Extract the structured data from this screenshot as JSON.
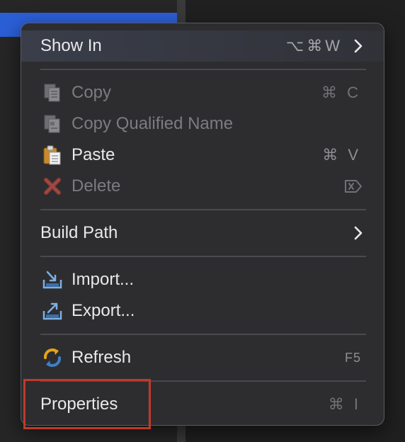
{
  "context_menu": {
    "show_in": {
      "label": "Show In",
      "shortcut": "⌥⌘W"
    },
    "copy": {
      "label": "Copy",
      "shortcut": "⌘ C",
      "icon": "copy-icon"
    },
    "copy_qualified": {
      "label": "Copy Qualified Name",
      "icon": "copy-qualified-name-icon"
    },
    "paste": {
      "label": "Paste",
      "shortcut": "⌘ V",
      "icon": "paste-icon"
    },
    "delete": {
      "label": "Delete",
      "shortcut": "⌦",
      "icon": "delete-icon"
    },
    "build_path": {
      "label": "Build Path"
    },
    "import": {
      "label": "Import...",
      "icon": "import-icon"
    },
    "export": {
      "label": "Export...",
      "icon": "export-icon"
    },
    "refresh": {
      "label": "Refresh",
      "shortcut": "F5",
      "icon": "refresh-icon"
    },
    "properties": {
      "label": "Properties",
      "shortcut": "⌘ I"
    }
  },
  "colors": {
    "menu_bg": "#2d2d30",
    "text": "#e9e9ea",
    "disabled_text": "#7c7c80",
    "selection_blue": "#2b5fd6",
    "highlight_red": "#c0392b"
  }
}
